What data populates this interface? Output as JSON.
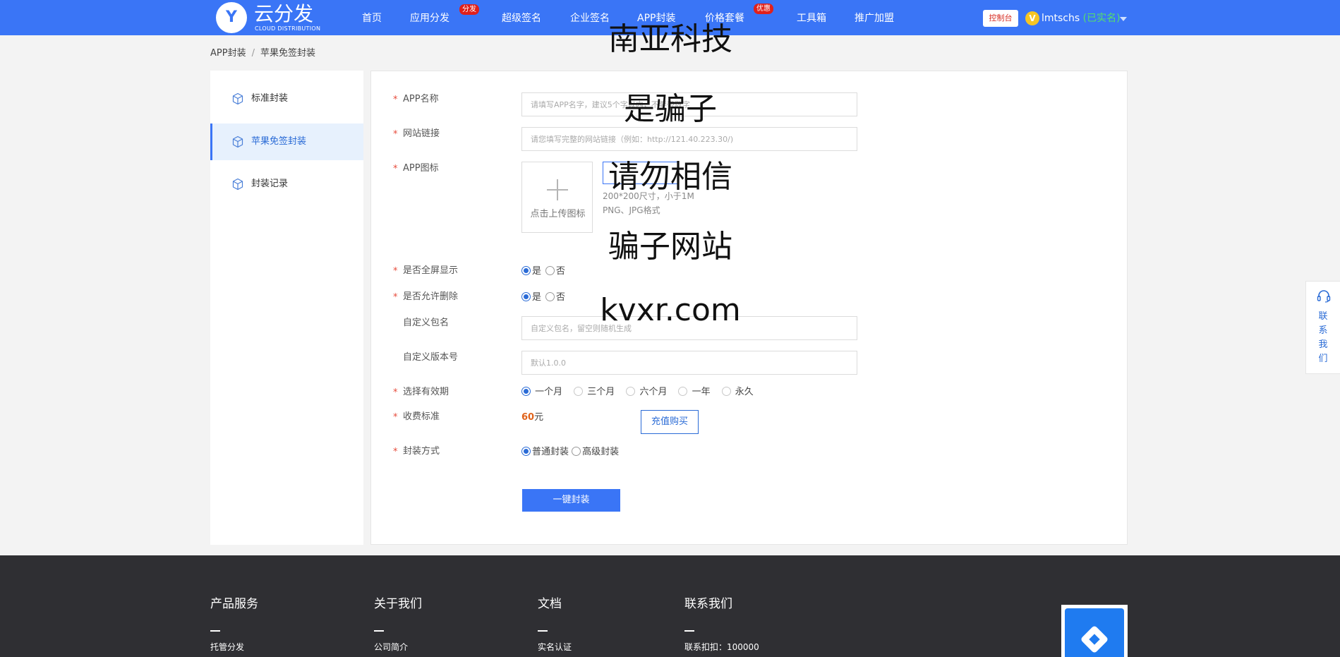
{
  "navbar": {
    "logo_letter": "Y",
    "logo_main": "云分发",
    "logo_sub": "CLOUD DISTRIBUTION",
    "items": [
      {
        "label": "首页"
      },
      {
        "label": "应用分发",
        "badge": "分发"
      },
      {
        "label": "超级签名"
      },
      {
        "label": "企业签名"
      },
      {
        "label": "APP封装"
      },
      {
        "label": "价格套餐",
        "badge": "优惠"
      },
      {
        "label": "工具箱"
      },
      {
        "label": "推广加盟"
      }
    ],
    "console_label": "控制台",
    "vip_letter": "V",
    "user_name": "lmtschs",
    "user_status": "(已实名)"
  },
  "breadcrumb": {
    "root": "APP封装",
    "separator": "/",
    "current": "苹果免签封装"
  },
  "sidebar": {
    "items": [
      {
        "label": "标准封装",
        "active": false
      },
      {
        "label": "苹果免签封装",
        "active": true
      },
      {
        "label": "封装记录",
        "active": false
      }
    ]
  },
  "form": {
    "req_mark": "*",
    "app_name": {
      "label": "APP名称",
      "placeholder": "请填写APP名字，建议5个字以内，不要带数字",
      "value": ""
    },
    "site_url": {
      "label": "网站链接",
      "placeholder": "请您填写完整的网站链接（例如：http://121.40.223.30/)",
      "value": ""
    },
    "app_icon": {
      "label": "APP图标",
      "upload_text": "点击上传图标",
      "hint_size": "200*200尺寸，小于1M",
      "hint_format": "PNG、JPG格式"
    },
    "fullscreen": {
      "label": "是否全屏显示",
      "yes": "是",
      "no": "否",
      "selected": "是"
    },
    "allow_delete": {
      "label": "是否允许删除",
      "yes": "是",
      "no": "否",
      "selected": "是"
    },
    "package_name": {
      "label": "自定义包名",
      "placeholder": "自定义包名，留空则随机生成",
      "value": ""
    },
    "version": {
      "label": "自定义版本号",
      "placeholder": "默认1.0.0",
      "value": ""
    },
    "validity": {
      "label": "选择有效期",
      "options": [
        "一个月",
        "三个月",
        "六个月",
        "一年",
        "永久"
      ],
      "selected": "一个月"
    },
    "fee": {
      "label": "收费标准",
      "amount": "60",
      "unit": "元",
      "recharge_label": "充值购买"
    },
    "pack_mode": {
      "label": "封装方式",
      "options": [
        "普通封装",
        "高级封装"
      ],
      "selected": "普通封装"
    },
    "submit_label": "一键封装"
  },
  "overlay": {
    "lines": [
      "南亚科技",
      "是骗子",
      "请勿相信",
      "骗子网站",
      "kvxr.com"
    ]
  },
  "contact_float": {
    "label": "联系我们"
  },
  "footer": {
    "columns": [
      {
        "title": "产品服务",
        "first_link": "托管分发"
      },
      {
        "title": "关于我们",
        "first_link": "公司简介"
      },
      {
        "title": "文档",
        "first_link": "实名认证"
      },
      {
        "title": "联系我们",
        "first_link": "联系扣扣：100000"
      }
    ]
  },
  "colors": {
    "brand": "#3a75f6",
    "badge": "#e0201b",
    "price": "#e0631b",
    "link": "#2a6bd6",
    "footer_bg": "#2f2f33"
  }
}
